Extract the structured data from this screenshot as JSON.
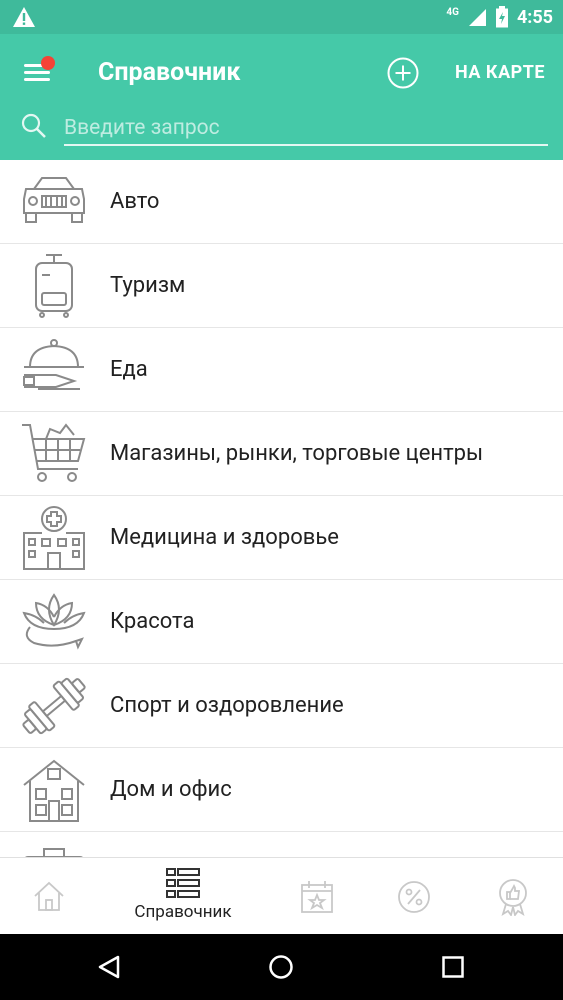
{
  "status_bar": {
    "network": "4G",
    "time": "4:55"
  },
  "app_bar": {
    "title": "Справочник",
    "map_button": "НА КАРТЕ"
  },
  "search": {
    "placeholder": "Введите запрос"
  },
  "categories": [
    {
      "label": "Авто",
      "icon": "car-icon"
    },
    {
      "label": "Туризм",
      "icon": "suitcase-icon"
    },
    {
      "label": "Еда",
      "icon": "food-cloche-icon"
    },
    {
      "label": "Магазины, рынки, торговые центры",
      "icon": "shopping-cart-icon"
    },
    {
      "label": "Медицина и здоровье",
      "icon": "hospital-icon"
    },
    {
      "label": "Красота",
      "icon": "lotus-icon"
    },
    {
      "label": "Спорт и оздоровление",
      "icon": "dumbbell-icon"
    },
    {
      "label": "Дом и офис",
      "icon": "house-icon"
    },
    {
      "label": "",
      "icon": "briefcase-icon"
    }
  ],
  "bottom_nav": [
    {
      "icon": "home-icon",
      "label": ""
    },
    {
      "icon": "directory-list-icon",
      "label": "Справочник",
      "active": true
    },
    {
      "icon": "calendar-star-icon",
      "label": ""
    },
    {
      "icon": "discount-percent-icon",
      "label": ""
    },
    {
      "icon": "award-like-icon",
      "label": ""
    }
  ],
  "colors": {
    "primary": "#45c9a8",
    "status_bar": "#3fba9b",
    "icon_gray": "#8a8a8a",
    "badge": "#f44336"
  }
}
